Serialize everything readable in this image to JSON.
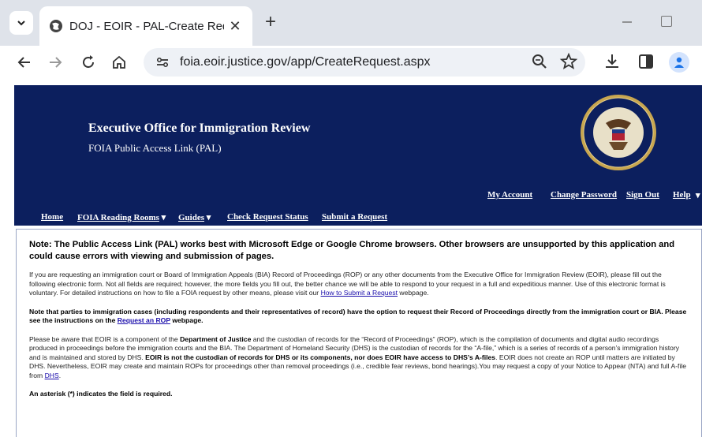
{
  "browser": {
    "tab_title": "DOJ - EOIR - PAL-Create Reque",
    "tab_close": "✕",
    "new_tab": "+",
    "url": "foia.eoir.justice.gov/app/CreateRequest.aspx"
  },
  "header": {
    "title": "Executive Office for Immigration Review",
    "subtitle": "FOIA Public Access Link (PAL)",
    "account_links": [
      "My Account",
      "Change Password",
      "Sign Out",
      "Help"
    ],
    "help_caret": "▾"
  },
  "nav": {
    "items": [
      {
        "label": "Home",
        "caret": ""
      },
      {
        "label": "FOIA Reading Rooms",
        "caret": "▾"
      },
      {
        "label": "Guides",
        "caret": "▾"
      },
      {
        "label": "Check Request Status",
        "caret": ""
      },
      {
        "label": "Submit a Request",
        "caret": ""
      }
    ]
  },
  "content": {
    "note": "Note: The Public Access Link (PAL) works best with Microsoft Edge or Google Chrome browsers. Other browsers are unsupported by this application and could cause errors with viewing and submission of pages.",
    "para1_text": "If you are requesting an immigration court or Board of Immigration Appeals (BIA) Record of Proceedings (ROP) or any other documents from the Executive Office for Immigration Review (EOIR), please fill out the following electronic form. Not all fields are required; however, the more fields you fill out, the better chance we will be able to respond to your request in a full and expeditious manner. Use of this electronic format is voluntary. For detailed instructions on how to file a FOIA request by other means, please visit our ",
    "para1_link": "How to Submit a Request",
    "para1_end": " webpage.",
    "para2_text": "Note that parties to immigration cases (including respondents and their representatives of record) have the option to request their Record of Proceedings directly from the immigration court or BIA. Please see the instructions on the ",
    "para2_link": "Request an ROP",
    "para2_end": " webpage.",
    "para3_a": "Please be aware that EOIR is a component of the ",
    "para3_b": "Department of Justice",
    "para3_c": " and the custodian of records for the “Record of Proceedings” (ROP), which is the compilation of documents and digital audio recordings produced in proceedings before the immigration courts and the BIA. The Department of Homeland Security (DHS) is the custodian of records for the “A-file,” which is a series of records of a person’s immigration history and is maintained and stored by DHS. ",
    "para3_d": "EOIR is not the custodian of records for DHS or its components, nor does EOIR have access to DHS’s A-files",
    "para3_e": ". EOIR does not create an ROP until matters are initiated by DHS. Nevertheless, EOIR may create and maintain ROPs for proceedings other than removal proceedings (i.e., credible fear reviews, bond hearings).You may request a copy of your Notice to Appear (NTA) and full A-file from ",
    "para3_link": "DHS",
    "para3_end": ".",
    "asterisk_note": "An asterisk (*) indicates the field is required."
  },
  "colors": {
    "banner": "#0c1f5e",
    "link": "#1a0dab"
  }
}
